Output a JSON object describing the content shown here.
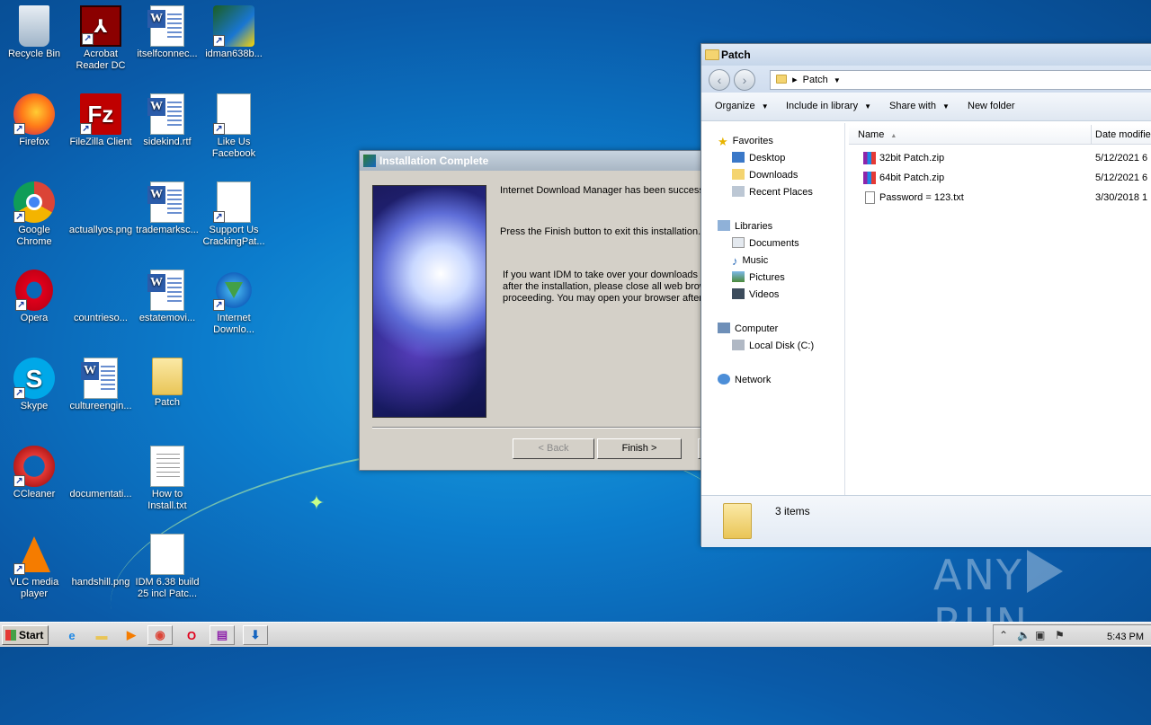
{
  "desktop": {
    "icons": [
      {
        "label": "Recycle Bin",
        "icon": "recycle-bin-icon"
      },
      {
        "label": "Acrobat Reader DC",
        "icon": "acrobat-icon"
      },
      {
        "label": "itselfconnec...",
        "icon": "word-doc-icon"
      },
      {
        "label": "idman638b...",
        "icon": "installer-icon"
      },
      {
        "label": "Firefox",
        "icon": "firefox-icon"
      },
      {
        "label": "FileZilla Client",
        "icon": "filezilla-icon"
      },
      {
        "label": "sidekind.rtf",
        "icon": "word-doc-icon"
      },
      {
        "label": "Like Us Facebook",
        "icon": "blank-doc-icon"
      },
      {
        "label": "Google Chrome",
        "icon": "chrome-icon"
      },
      {
        "label": "actuallyos.png",
        "icon": "blank-image-icon"
      },
      {
        "label": "trademarksc...",
        "icon": "word-doc-icon"
      },
      {
        "label": "Support Us CrackingPat...",
        "icon": "blank-doc-icon"
      },
      {
        "label": "Opera",
        "icon": "opera-icon"
      },
      {
        "label": "countrieso...",
        "icon": "blank-image-icon"
      },
      {
        "label": "estatemovi...",
        "icon": "word-doc-icon"
      },
      {
        "label": "Internet Downlo...",
        "icon": "idm-icon"
      },
      {
        "label": "Skype",
        "icon": "skype-icon"
      },
      {
        "label": "cultureengin...",
        "icon": "word-doc-icon"
      },
      {
        "label": "Patch",
        "icon": "folder-icon"
      },
      {
        "label": "CCleaner",
        "icon": "ccleaner-icon"
      },
      {
        "label": "documentati...",
        "icon": "blank-image-icon"
      },
      {
        "label": "How to Install.txt",
        "icon": "text-doc-icon"
      },
      {
        "label": "VLC media player",
        "icon": "vlc-icon"
      },
      {
        "label": "handshill.png",
        "icon": "blank-image-icon"
      },
      {
        "label": "IDM 6.38 build 25 incl Patc...",
        "icon": "blank-doc-icon"
      }
    ]
  },
  "install_dialog": {
    "title": "Installation Complete",
    "line1": "Internet Download Manager has been successf",
    "line2": "Press the Finish button to exit this installation.",
    "line3a": "If you want IDM to take over your downloads",
    "line3b": "after the installation, please close all web brow",
    "line3c": "proceeding. You may open your browser after",
    "back_label": "< Back",
    "finish_label": "Finish >"
  },
  "explorer": {
    "title": "Patch",
    "address": "Patch",
    "toolbar": {
      "organize": "Organize",
      "include_in_library": "Include in library",
      "share_with": "Share with",
      "new_folder": "New folder"
    },
    "nav": {
      "favorites": "Favorites",
      "desktop": "Desktop",
      "downloads": "Downloads",
      "recent_places": "Recent Places",
      "libraries": "Libraries",
      "documents": "Documents",
      "music": "Music",
      "pictures": "Pictures",
      "videos": "Videos",
      "computer": "Computer",
      "local_disk": "Local Disk (C:)",
      "network": "Network"
    },
    "columns": {
      "name": "Name",
      "date_modified": "Date modifie"
    },
    "files": [
      {
        "name": "32bit Patch.zip",
        "date": "5/12/2021 6",
        "icon": "winrar-icon"
      },
      {
        "name": "64bit Patch.zip",
        "date": "5/12/2021 6",
        "icon": "winrar-icon"
      },
      {
        "name": "Password = 123.txt",
        "date": "3/30/2018 1",
        "icon": "text-file-icon"
      }
    ],
    "status": "3 items"
  },
  "taskbar": {
    "start_label": "Start",
    "clock": "5:43 PM"
  },
  "watermark": {
    "left": "ANY",
    "right": "RUN"
  }
}
